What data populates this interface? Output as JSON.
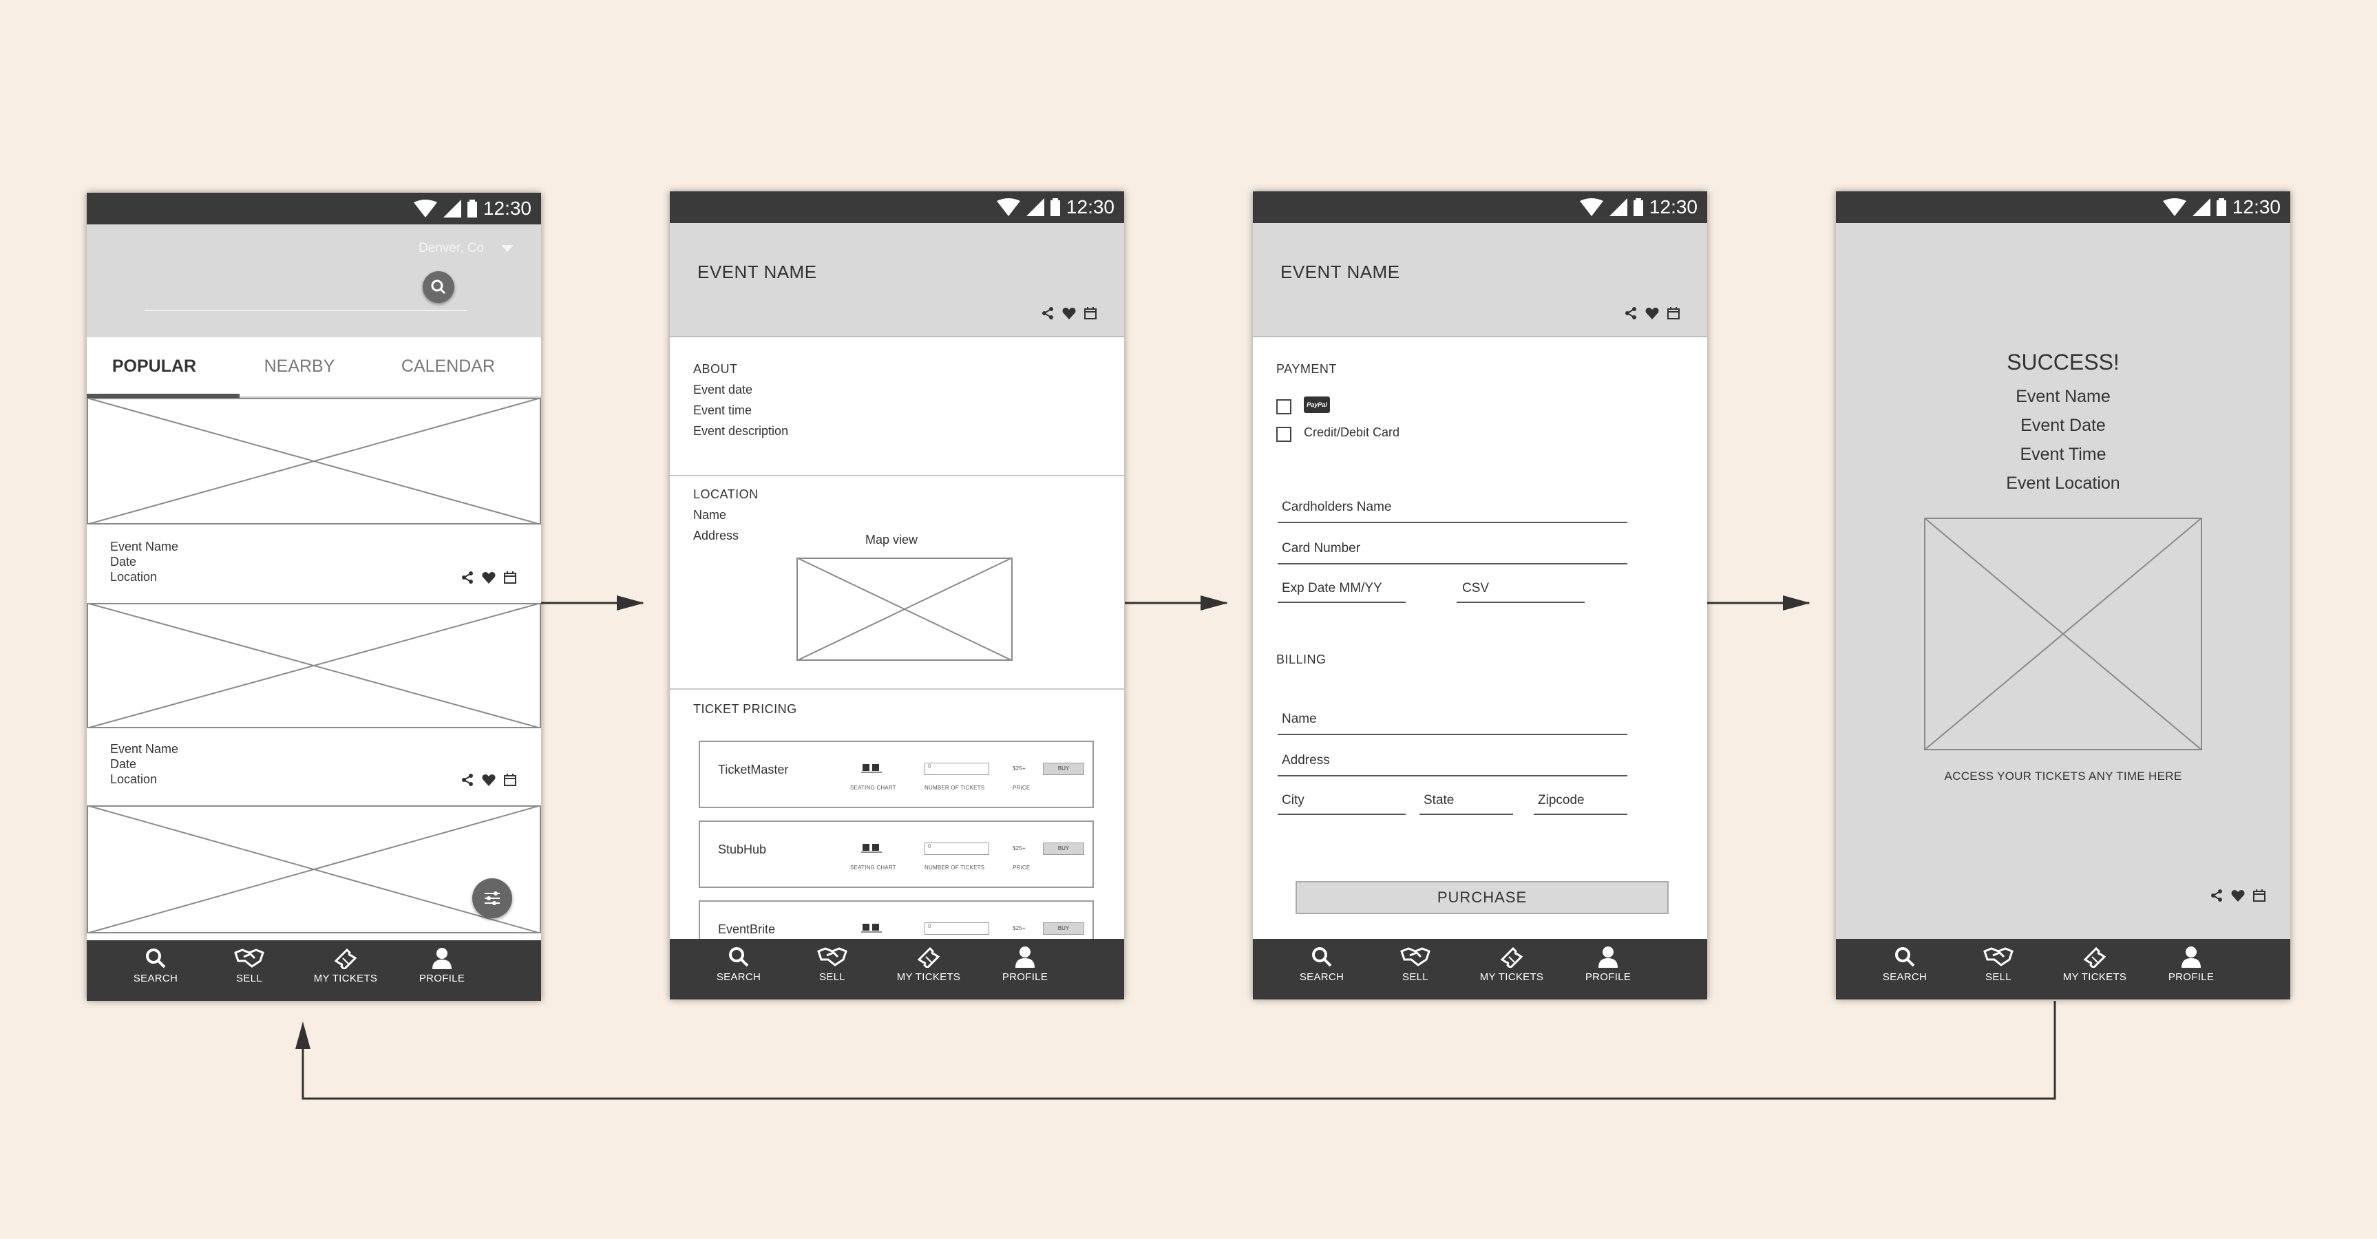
{
  "status_time": "12:30",
  "nav": [
    {
      "label": "SEARCH",
      "icon": "search-icon"
    },
    {
      "label": "SELL",
      "icon": "handshake-icon"
    },
    {
      "label": "MY TICKETS",
      "icon": "ticket-icon"
    },
    {
      "label": "PROFILE",
      "icon": "person-icon"
    }
  ],
  "screen1": {
    "location": "Denver, Co",
    "tabs": [
      "POPULAR",
      "NEARBY",
      "CALENDAR"
    ],
    "cards": [
      {
        "name": "Event Name",
        "date": "Date",
        "location": "Location"
      },
      {
        "name": "Event Name",
        "date": "Date",
        "location": "Location"
      }
    ]
  },
  "screen2": {
    "event_name": "EVENT NAME",
    "about": {
      "label": "ABOUT",
      "lines": [
        "Event date",
        "Event time",
        "Event description"
      ]
    },
    "location": {
      "label": "LOCATION",
      "lines": [
        "Name",
        "Address"
      ],
      "map_label": "Map view"
    },
    "pricing": {
      "label": "TICKET PRICING",
      "sellers": [
        "TicketMaster",
        "StubHub",
        "EventBrite"
      ],
      "seating_label": "SEATING CHART",
      "number_label": "NUMBER OF TICKETS",
      "price_label": "PRICE",
      "price_value": "$25+",
      "count_value": "0",
      "buy_label": "BUY"
    }
  },
  "screen3": {
    "event_name": "EVENT NAME",
    "payment_label": "PAYMENT",
    "paypal": "PayPal",
    "credit": "Credit/Debit Card",
    "fields": {
      "cardholder": "Cardholders Name",
      "card_number": "Card Number",
      "exp": "Exp Date MM/YY",
      "csv": "CSV"
    },
    "billing_label": "BILLING",
    "billing": {
      "name": "Name",
      "address": "Address",
      "city": "City",
      "state": "State",
      "zip": "Zipcode"
    },
    "purchase": "PURCHASE"
  },
  "screen4": {
    "title": "SUCCESS!",
    "lines": [
      "Event Name",
      "Event Date",
      "Event Time",
      "Event Location"
    ],
    "access_text": "ACCESS YOUR TICKETS ANY TIME HERE"
  },
  "colors": {
    "background": "#f8eee4",
    "bars": "#3a3a3a",
    "header_gray": "#d9d9d9"
  }
}
